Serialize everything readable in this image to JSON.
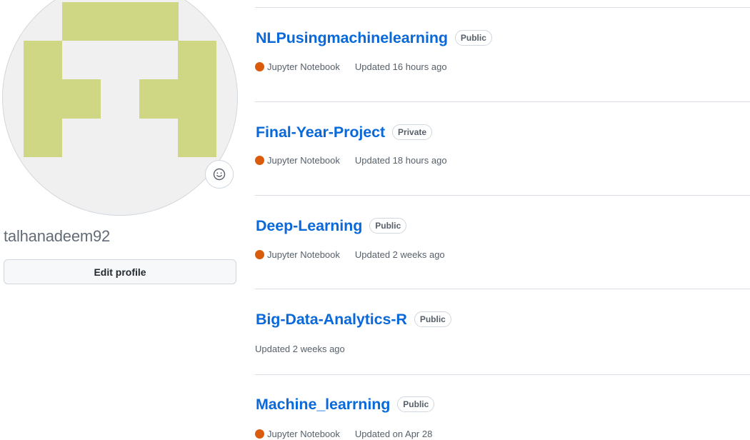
{
  "profile": {
    "username": "talhanadeem92",
    "edit_label": "Edit profile",
    "avatar_colors": {
      "bg": "#f0f0f0",
      "fg": "#d0d784"
    }
  },
  "colors": {
    "link": "#0969da",
    "jupyter": "#da5b0b"
  },
  "repos": [
    {
      "name": "NLPusingmachinelearning",
      "visibility": "Public",
      "language": "Jupyter Notebook",
      "updated": "Updated 16 hours ago"
    },
    {
      "name": "Final-Year-Project",
      "visibility": "Private",
      "language": "Jupyter Notebook",
      "updated": "Updated 18 hours ago"
    },
    {
      "name": "Deep-Learning",
      "visibility": "Public",
      "language": "Jupyter Notebook",
      "updated": "Updated 2 weeks ago"
    },
    {
      "name": "Big-Data-Analytics-R",
      "visibility": "Public",
      "language": "",
      "updated": "Updated 2 weeks ago"
    },
    {
      "name": "Machine_learrning",
      "visibility": "Public",
      "language": "Jupyter Notebook",
      "updated": "Updated on Apr 28"
    }
  ]
}
